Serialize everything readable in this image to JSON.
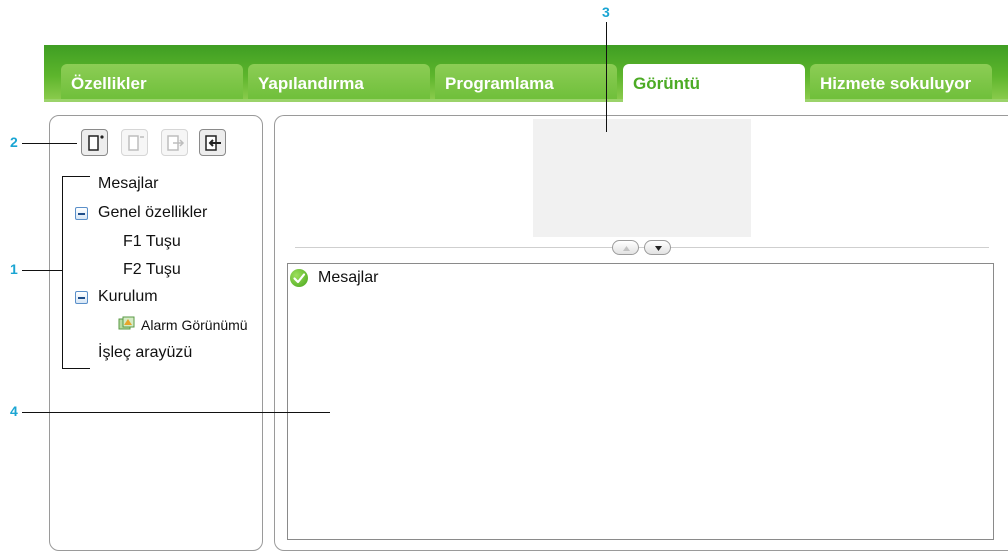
{
  "tabs": [
    {
      "label": "Özellikler",
      "active": false
    },
    {
      "label": "Yapılandırma",
      "active": false
    },
    {
      "label": "Programlama",
      "active": false
    },
    {
      "label": "Görüntü",
      "active": true
    },
    {
      "label": "Hizmete sokuluyor",
      "active": false
    }
  ],
  "toolbar": {
    "buttons": [
      {
        "icon": "add-screen-icon",
        "enabled": true
      },
      {
        "icon": "remove-screen-icon",
        "enabled": false
      },
      {
        "icon": "export-icon",
        "enabled": false
      },
      {
        "icon": "import-icon",
        "enabled": true
      }
    ]
  },
  "tree": {
    "items": [
      {
        "label": "Mesajlar"
      },
      {
        "label": "Genel özellikler",
        "expanded": true
      },
      {
        "label": "F1 Tuşu"
      },
      {
        "label": "F2 Tuşu"
      },
      {
        "label": "Kurulum",
        "expanded": true
      },
      {
        "label": "Alarm Görünümü",
        "icon": "alarm-view-icon"
      },
      {
        "label": "İşleç arayüzü"
      }
    ]
  },
  "content": {
    "header_label": "Mesajlar",
    "header_icon": "check-circle-icon"
  },
  "callouts": {
    "c1": "1",
    "c2": "2",
    "c3": "3",
    "c4": "4"
  },
  "colors": {
    "brand_green": "#5db52c",
    "callout_blue": "#1aa5d3"
  }
}
